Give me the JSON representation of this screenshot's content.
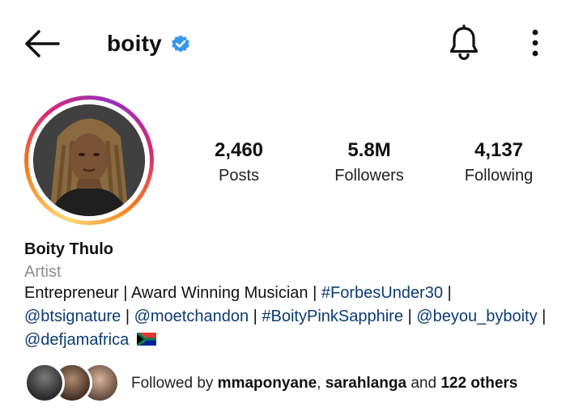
{
  "header": {
    "username": "boity",
    "icons": {
      "back": "back-arrow-icon",
      "verified": "verified-badge-icon",
      "notifications": "bell-icon",
      "more": "more-options-icon"
    },
    "verified_color": "#3897f0"
  },
  "profile": {
    "avatar_alt": "profile-photo",
    "ring_colors": [
      "#feda75",
      "#fa7e1e",
      "#d62976",
      "#962fbf"
    ]
  },
  "stats": {
    "posts_count": "2,460",
    "posts_label": "Posts",
    "followers_count": "5.8M",
    "followers_label": "Followers",
    "following_count": "4,137",
    "following_label": "Following"
  },
  "bio": {
    "full_name": "Boity Thulo",
    "category": "Artist",
    "line1_plain": "Entrepreneur | Award Winning Musician | ",
    "line1_tag": "#ForbesUnder30",
    "line1_end": " |",
    "tag_btsignature": "@btsignature",
    "sep": " | ",
    "tag_moetchandon": "@moetchandon",
    "tag_pinksapphire": "#BoityPinkSapphire",
    "tag_beyou": "@beyou_byboity",
    "sep_end": " |",
    "tag_defjam": "@defjamafrica",
    "flag": "south-africa-flag-icon",
    "link_color": "#0b3b73"
  },
  "followed_by": {
    "prefix": "Followed by ",
    "user1": "mmaponyane",
    "comma": ", ",
    "user2": "sarahlanga",
    "and": " and ",
    "others": "122 others"
  }
}
